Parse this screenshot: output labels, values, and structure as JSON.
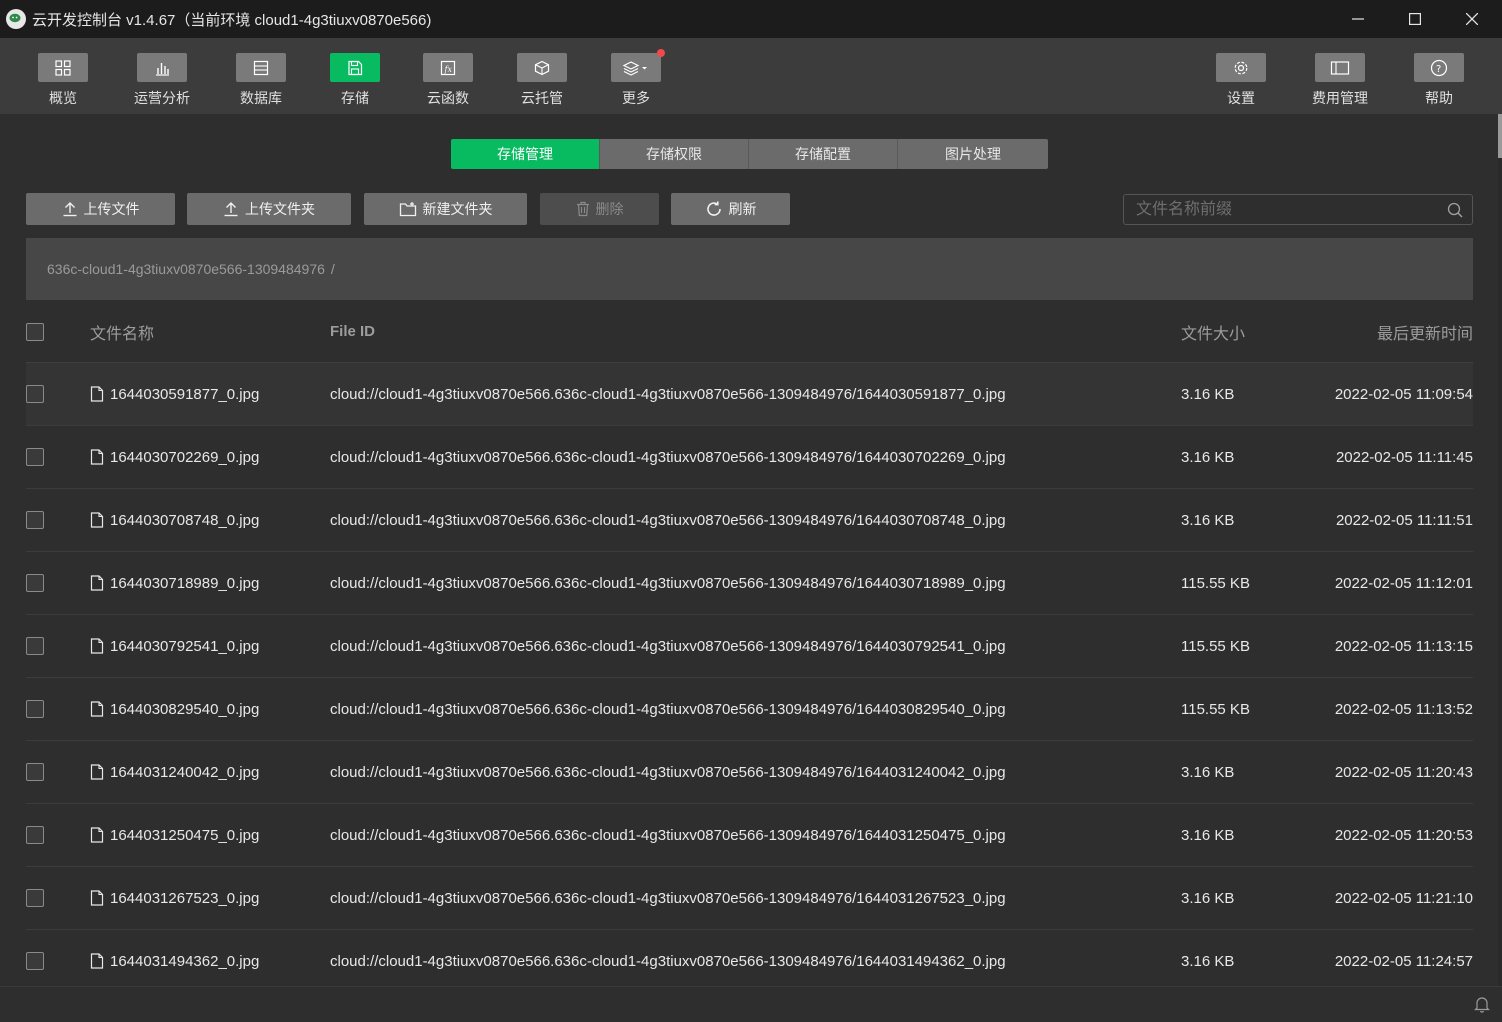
{
  "window": {
    "title": "云开发控制台 v1.4.67（当前环境 cloud1-4g3tiuxv0870e566)"
  },
  "toolbar": {
    "left": [
      {
        "label": "概览",
        "icon": "grid-icon"
      },
      {
        "label": "运营分析",
        "icon": "bar-chart-icon"
      },
      {
        "label": "数据库",
        "icon": "database-icon"
      },
      {
        "label": "存储",
        "icon": "storage-icon",
        "active": true
      },
      {
        "label": "云函数",
        "icon": "function-icon"
      },
      {
        "label": "云托管",
        "icon": "cube-icon"
      },
      {
        "label": "更多",
        "icon": "layers-icon",
        "badge": true
      }
    ],
    "right": [
      {
        "label": "设置",
        "icon": "gear-icon"
      },
      {
        "label": "费用管理",
        "icon": "billing-icon"
      },
      {
        "label": "帮助",
        "icon": "help-icon"
      }
    ]
  },
  "subtabs": [
    {
      "label": "存储管理",
      "active": true
    },
    {
      "label": "存储权限"
    },
    {
      "label": "存储配置"
    },
    {
      "label": "图片处理"
    }
  ],
  "actions": {
    "upload_file": "上传文件",
    "upload_folder": "上传文件夹",
    "new_folder": "新建文件夹",
    "delete": "删除",
    "refresh": "刷新"
  },
  "search": {
    "placeholder": "文件名称前缀",
    "value": ""
  },
  "breadcrumb": {
    "path": "636c-cloud1-4g3tiuxv0870e566-1309484976",
    "separator": "/"
  },
  "table": {
    "headers": {
      "name": "文件名称",
      "file_id": "File ID",
      "size": "文件大小",
      "updated": "最后更新时间"
    },
    "rows": [
      {
        "name": "1644030591877_0.jpg",
        "file_id": "cloud://cloud1-4g3tiuxv0870e566.636c-cloud1-4g3tiuxv0870e566-1309484976/1644030591877_0.jpg",
        "size": "3.16 KB",
        "updated": "2022-02-05 11:09:54"
      },
      {
        "name": "1644030702269_0.jpg",
        "file_id": "cloud://cloud1-4g3tiuxv0870e566.636c-cloud1-4g3tiuxv0870e566-1309484976/1644030702269_0.jpg",
        "size": "3.16 KB",
        "updated": "2022-02-05 11:11:45"
      },
      {
        "name": "1644030708748_0.jpg",
        "file_id": "cloud://cloud1-4g3tiuxv0870e566.636c-cloud1-4g3tiuxv0870e566-1309484976/1644030708748_0.jpg",
        "size": "3.16 KB",
        "updated": "2022-02-05 11:11:51"
      },
      {
        "name": "1644030718989_0.jpg",
        "file_id": "cloud://cloud1-4g3tiuxv0870e566.636c-cloud1-4g3tiuxv0870e566-1309484976/1644030718989_0.jpg",
        "size": "115.55 KB",
        "updated": "2022-02-05 11:12:01"
      },
      {
        "name": "1644030792541_0.jpg",
        "file_id": "cloud://cloud1-4g3tiuxv0870e566.636c-cloud1-4g3tiuxv0870e566-1309484976/1644030792541_0.jpg",
        "size": "115.55 KB",
        "updated": "2022-02-05 11:13:15"
      },
      {
        "name": "1644030829540_0.jpg",
        "file_id": "cloud://cloud1-4g3tiuxv0870e566.636c-cloud1-4g3tiuxv0870e566-1309484976/1644030829540_0.jpg",
        "size": "115.55 KB",
        "updated": "2022-02-05 11:13:52"
      },
      {
        "name": "1644031240042_0.jpg",
        "file_id": "cloud://cloud1-4g3tiuxv0870e566.636c-cloud1-4g3tiuxv0870e566-1309484976/1644031240042_0.jpg",
        "size": "3.16 KB",
        "updated": "2022-02-05 11:20:43"
      },
      {
        "name": "1644031250475_0.jpg",
        "file_id": "cloud://cloud1-4g3tiuxv0870e566.636c-cloud1-4g3tiuxv0870e566-1309484976/1644031250475_0.jpg",
        "size": "3.16 KB",
        "updated": "2022-02-05 11:20:53"
      },
      {
        "name": "1644031267523_0.jpg",
        "file_id": "cloud://cloud1-4g3tiuxv0870e566.636c-cloud1-4g3tiuxv0870e566-1309484976/1644031267523_0.jpg",
        "size": "3.16 KB",
        "updated": "2022-02-05 11:21:10"
      },
      {
        "name": "1644031494362_0.jpg",
        "file_id": "cloud://cloud1-4g3tiuxv0870e566.636c-cloud1-4g3tiuxv0870e566-1309484976/1644031494362_0.jpg",
        "size": "3.16 KB",
        "updated": "2022-02-05 11:24:57"
      }
    ]
  },
  "colors": {
    "accent": "#09bb60",
    "badge": "#f04a4a",
    "toolbar_bg": "#3c3c3c",
    "titlebar_bg": "#1c1c1c"
  }
}
